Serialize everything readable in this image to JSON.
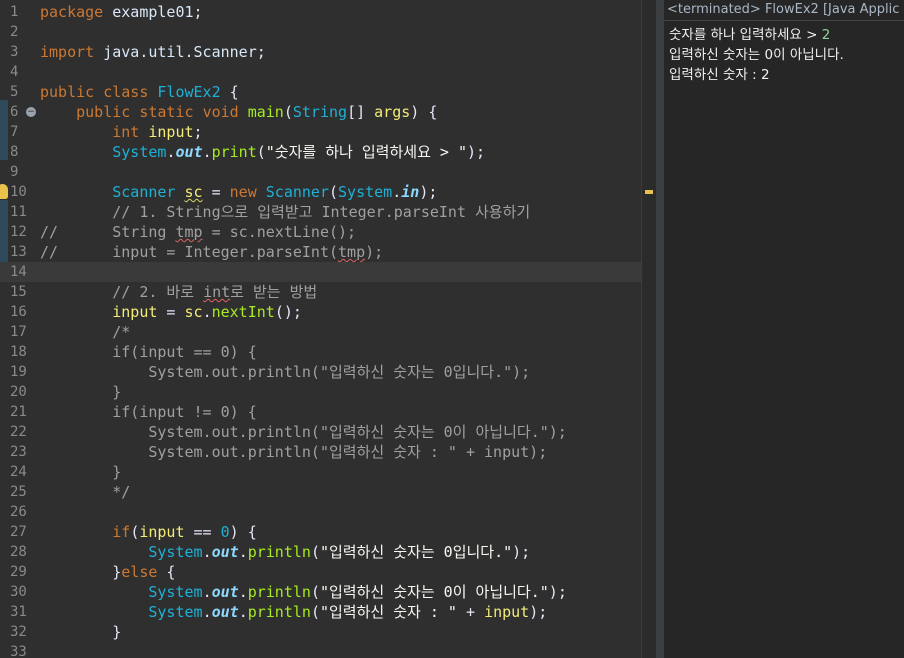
{
  "editor": {
    "lines": [
      {
        "n": "1",
        "segs": [
          {
            "t": "package",
            "c": "kw"
          },
          {
            "t": " example01;",
            "c": ""
          }
        ]
      },
      {
        "n": "2",
        "segs": []
      },
      {
        "n": "3",
        "segs": [
          {
            "t": "import",
            "c": "kw"
          },
          {
            "t": " java.util.Scanner;",
            "c": ""
          }
        ]
      },
      {
        "n": "4",
        "segs": []
      },
      {
        "n": "5",
        "segs": [
          {
            "t": "public",
            "c": "kw"
          },
          {
            "t": " ",
            "c": ""
          },
          {
            "t": "class",
            "c": "kw"
          },
          {
            "t": " ",
            "c": ""
          },
          {
            "t": "FlowEx2",
            "c": "ty"
          },
          {
            "t": " {",
            "c": "pun"
          }
        ]
      },
      {
        "n": "6",
        "segs": [
          {
            "t": "    ",
            "c": ""
          },
          {
            "t": "public",
            "c": "kw"
          },
          {
            "t": " ",
            "c": ""
          },
          {
            "t": "static",
            "c": "kw"
          },
          {
            "t": " ",
            "c": ""
          },
          {
            "t": "void",
            "c": "kw"
          },
          {
            "t": " ",
            "c": ""
          },
          {
            "t": "main",
            "c": "mth"
          },
          {
            "t": "(",
            "c": "pun"
          },
          {
            "t": "String",
            "c": "ty"
          },
          {
            "t": "[] ",
            "c": "pun"
          },
          {
            "t": "args",
            "c": "var"
          },
          {
            "t": ") {",
            "c": "pun"
          }
        ]
      },
      {
        "n": "7",
        "segs": [
          {
            "t": "        ",
            "c": ""
          },
          {
            "t": "int",
            "c": "kw"
          },
          {
            "t": " ",
            "c": ""
          },
          {
            "t": "input",
            "c": "var"
          },
          {
            "t": ";",
            "c": "pun"
          }
        ]
      },
      {
        "n": "8",
        "segs": [
          {
            "t": "        ",
            "c": ""
          },
          {
            "t": "System",
            "c": "ty"
          },
          {
            "t": ".",
            "c": "pun"
          },
          {
            "t": "out",
            "c": "fld"
          },
          {
            "t": ".",
            "c": "pun"
          },
          {
            "t": "print",
            "c": "mth"
          },
          {
            "t": "(",
            "c": "pun"
          },
          {
            "t": "\"숫자를 하나 입력하세요 > \"",
            "c": "str"
          },
          {
            "t": ");",
            "c": "pun"
          }
        ]
      },
      {
        "n": "9",
        "segs": []
      },
      {
        "n": "10",
        "segs": [
          {
            "t": "        ",
            "c": ""
          },
          {
            "t": "Scanner",
            "c": "ty"
          },
          {
            "t": " ",
            "c": ""
          },
          {
            "t": "sc",
            "c": "var warn"
          },
          {
            "t": " = ",
            "c": "pun"
          },
          {
            "t": "new",
            "c": "kw"
          },
          {
            "t": " ",
            "c": ""
          },
          {
            "t": "Scanner",
            "c": "ty"
          },
          {
            "t": "(",
            "c": "pun"
          },
          {
            "t": "System",
            "c": "ty"
          },
          {
            "t": ".",
            "c": "pun"
          },
          {
            "t": "in",
            "c": "fld"
          },
          {
            "t": ");",
            "c": "pun"
          }
        ]
      },
      {
        "n": "11",
        "segs": [
          {
            "t": "        // 1. String으로 입력받고 Integer.parseInt 사용하기",
            "c": "cm"
          }
        ]
      },
      {
        "n": "12",
        "segs": [
          {
            "t": "//      String ",
            "c": "cm"
          },
          {
            "t": "tmp",
            "c": "cm err"
          },
          {
            "t": " = sc.nextLine();",
            "c": "cm"
          }
        ]
      },
      {
        "n": "13",
        "segs": [
          {
            "t": "//      input = Integer.parseInt(",
            "c": "cm"
          },
          {
            "t": "tmp",
            "c": "cm err"
          },
          {
            "t": ");",
            "c": "cm"
          }
        ]
      },
      {
        "n": "14",
        "segs": []
      },
      {
        "n": "15",
        "segs": [
          {
            "t": "        // 2. 바로 ",
            "c": "cm"
          },
          {
            "t": "int",
            "c": "cm err"
          },
          {
            "t": "로 받는 방법",
            "c": "cm"
          }
        ]
      },
      {
        "n": "16",
        "segs": [
          {
            "t": "        ",
            "c": ""
          },
          {
            "t": "input",
            "c": "var"
          },
          {
            "t": " = ",
            "c": "pun"
          },
          {
            "t": "sc",
            "c": "var"
          },
          {
            "t": ".",
            "c": "pun"
          },
          {
            "t": "nextInt",
            "c": "mth"
          },
          {
            "t": "();",
            "c": "pun"
          }
        ]
      },
      {
        "n": "17",
        "segs": [
          {
            "t": "        /*",
            "c": "cm"
          }
        ]
      },
      {
        "n": "18",
        "segs": [
          {
            "t": "        if(input == 0) {",
            "c": "cm"
          }
        ]
      },
      {
        "n": "19",
        "segs": [
          {
            "t": "            System.out.println(\"입력하신 숫자는 0입니다.\");",
            "c": "cm"
          }
        ]
      },
      {
        "n": "20",
        "segs": [
          {
            "t": "        }",
            "c": "cm"
          }
        ]
      },
      {
        "n": "21",
        "segs": [
          {
            "t": "        if(input != 0) {",
            "c": "cm"
          }
        ]
      },
      {
        "n": "22",
        "segs": [
          {
            "t": "            System.out.println(\"입력하신 숫자는 0이 아닙니다.\");",
            "c": "cm"
          }
        ]
      },
      {
        "n": "23",
        "segs": [
          {
            "t": "            System.out.println(\"입력하신 숫자 : \" + input);",
            "c": "cm"
          }
        ]
      },
      {
        "n": "24",
        "segs": [
          {
            "t": "        }",
            "c": "cm"
          }
        ]
      },
      {
        "n": "25",
        "segs": [
          {
            "t": "        */",
            "c": "cm"
          }
        ]
      },
      {
        "n": "26",
        "segs": []
      },
      {
        "n": "27",
        "segs": [
          {
            "t": "        ",
            "c": ""
          },
          {
            "t": "if",
            "c": "kw"
          },
          {
            "t": "(",
            "c": "pun"
          },
          {
            "t": "input",
            "c": "var"
          },
          {
            "t": " == ",
            "c": "pun"
          },
          {
            "t": "0",
            "c": "ty"
          },
          {
            "t": ") {",
            "c": "pun"
          }
        ]
      },
      {
        "n": "28",
        "segs": [
          {
            "t": "            ",
            "c": ""
          },
          {
            "t": "System",
            "c": "ty"
          },
          {
            "t": ".",
            "c": "pun"
          },
          {
            "t": "out",
            "c": "fld"
          },
          {
            "t": ".",
            "c": "pun"
          },
          {
            "t": "println",
            "c": "mth"
          },
          {
            "t": "(",
            "c": "pun"
          },
          {
            "t": "\"입력하신 숫자는 0입니다.\"",
            "c": "str"
          },
          {
            "t": ");",
            "c": "pun"
          }
        ]
      },
      {
        "n": "29",
        "segs": [
          {
            "t": "        }",
            "c": "pun"
          },
          {
            "t": "else",
            "c": "kw"
          },
          {
            "t": " {",
            "c": "pun"
          }
        ]
      },
      {
        "n": "30",
        "segs": [
          {
            "t": "            ",
            "c": ""
          },
          {
            "t": "System",
            "c": "ty"
          },
          {
            "t": ".",
            "c": "pun"
          },
          {
            "t": "out",
            "c": "fld"
          },
          {
            "t": ".",
            "c": "pun"
          },
          {
            "t": "println",
            "c": "mth"
          },
          {
            "t": "(",
            "c": "pun"
          },
          {
            "t": "\"입력하신 숫자는 0이 아닙니다.\"",
            "c": "str"
          },
          {
            "t": ");",
            "c": "pun"
          }
        ]
      },
      {
        "n": "31",
        "segs": [
          {
            "t": "            ",
            "c": ""
          },
          {
            "t": "System",
            "c": "ty"
          },
          {
            "t": ".",
            "c": "pun"
          },
          {
            "t": "out",
            "c": "fld"
          },
          {
            "t": ".",
            "c": "pun"
          },
          {
            "t": "println",
            "c": "mth"
          },
          {
            "t": "(",
            "c": "pun"
          },
          {
            "t": "\"입력하신 숫자 : \"",
            "c": "str"
          },
          {
            "t": " + ",
            "c": "pun"
          },
          {
            "t": "input",
            "c": "var"
          },
          {
            "t": ");",
            "c": "pun"
          }
        ]
      },
      {
        "n": "32",
        "segs": [
          {
            "t": "        }",
            "c": "pun"
          }
        ]
      },
      {
        "n": "33",
        "segs": []
      }
    ],
    "current_line": "14",
    "fold_marker_line": "6",
    "warning_marker_line": "10"
  },
  "console": {
    "header": "<terminated> FlowEx2 [Java Applic",
    "lines": [
      {
        "prompt": "숫자를 하나 입력하세요 > ",
        "input": "2"
      },
      {
        "prompt": "입력하신 숫자는 0이 아닙니다.",
        "input": ""
      },
      {
        "prompt": "입력하신 숫자 : 2",
        "input": ""
      }
    ]
  },
  "colors": {
    "editor_bg": "#2f2f2f",
    "console_bg": "#262626",
    "keyword": "#cc7832",
    "type": "#1eb1d6",
    "method": "#a7ec21",
    "variable": "#f3ec79",
    "comment": "#a0a0a0",
    "console_input": "#8fd19e"
  }
}
